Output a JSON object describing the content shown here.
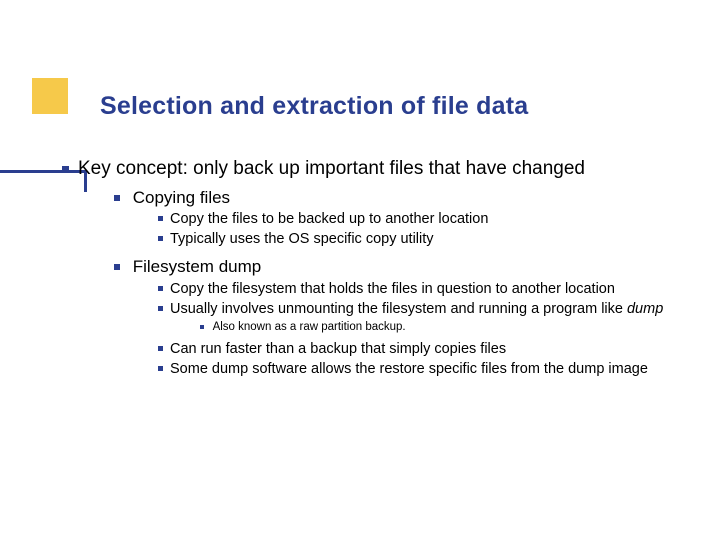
{
  "title": "Selection and extraction of file data",
  "body": {
    "lvl0": "Key concept: only back up important files that have changed",
    "copying": {
      "label": "Copying files",
      "items": [
        "Copy the files to be backed up to another location",
        "Typically uses the OS specific copy utility"
      ]
    },
    "fsdump": {
      "label": "Filesystem dump",
      "items": {
        "0": "Copy the filesystem that holds the files in question to another location",
        "1a": "Usually involves unmounting the filesystem and running a program like ",
        "1b": "dump",
        "2": "Can run faster than a backup that simply copies files",
        "3": "Some dump software allows the restore specific files from the dump image"
      },
      "sub": {
        "0": "Also known as a raw partition backup."
      }
    }
  }
}
